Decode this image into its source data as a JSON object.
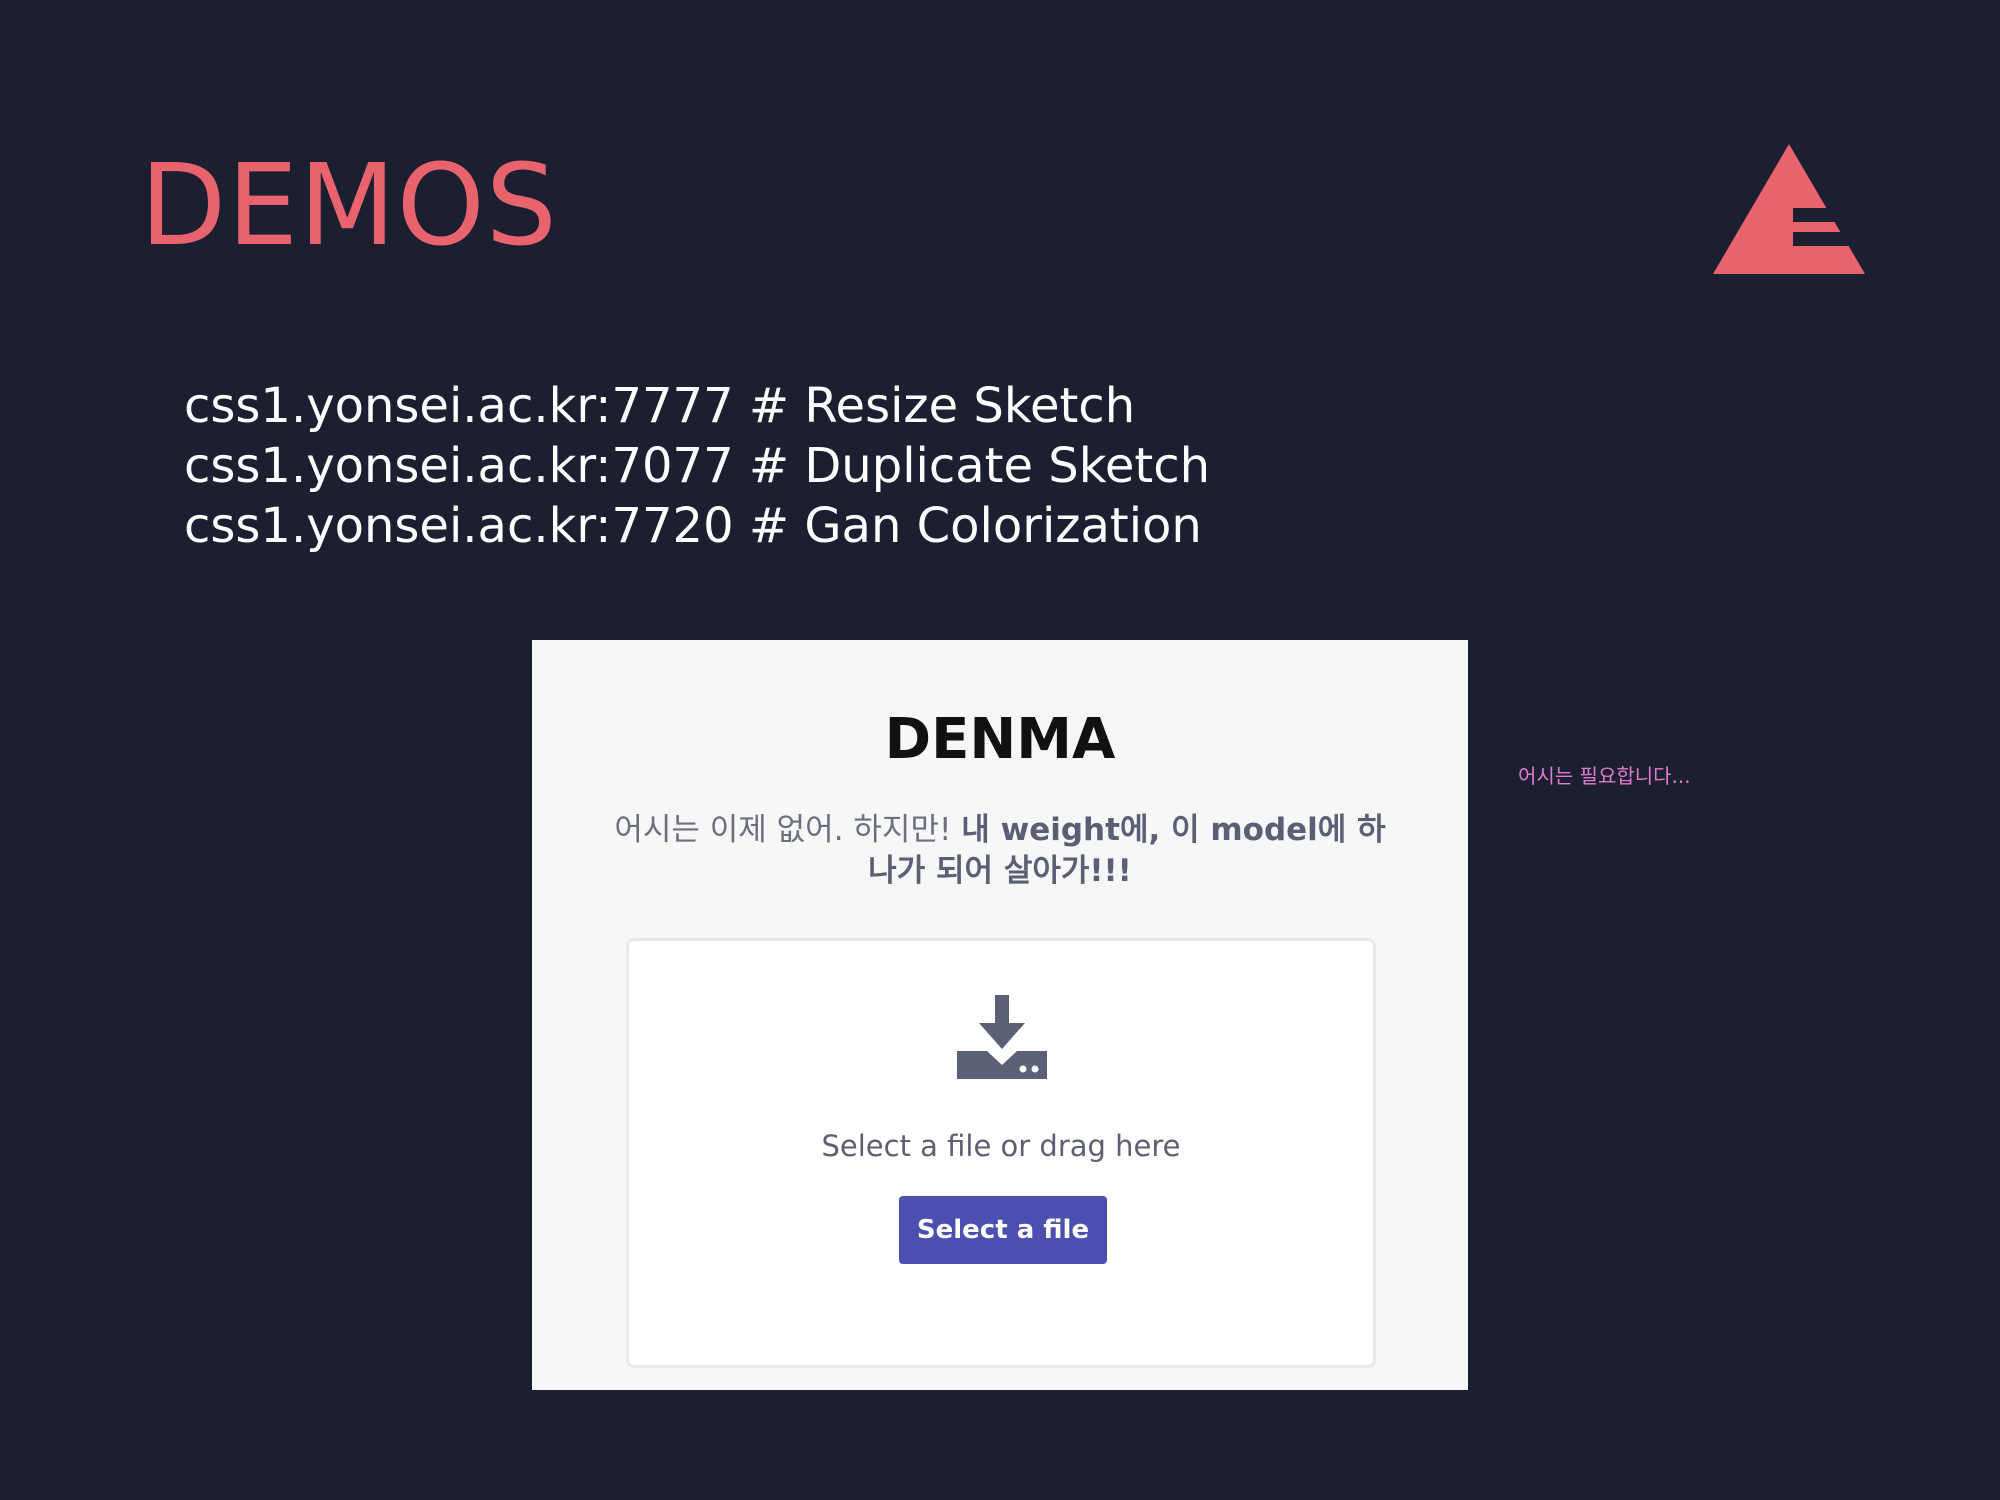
{
  "slide": {
    "title": "DEMOS",
    "logo_icon": "triangle-e-logo-icon",
    "accent_color": "#e8636e",
    "background_color": "#1c1f2f"
  },
  "links": [
    "css1.yonsei.ac.kr:7777 # Resize Sketch",
    "css1.yonsei.ac.kr:7077 # Duplicate Sketch",
    "css1.yonsei.ac.kr:7720 # Gan Colorization"
  ],
  "app": {
    "title": "DENMA",
    "tagline_regular": "어시는 이제 없어. 하지만!",
    "tagline_bold": "내 weight에, 이 model에 하나가 되어 살아가!!!",
    "dropzone": {
      "icon": "download-icon",
      "hint": "Select a file or drag here",
      "button_label": "Select a file",
      "button_color": "#4a4fb0"
    }
  },
  "side_note": "어시는 필요합니다..."
}
